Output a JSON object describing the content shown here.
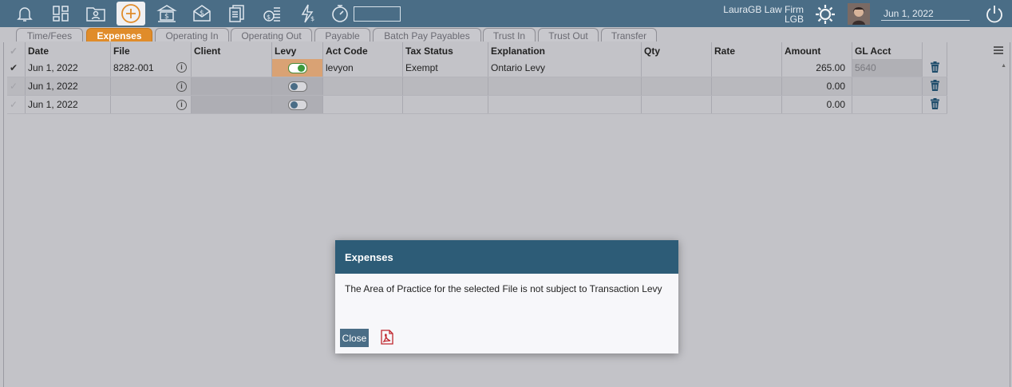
{
  "header": {
    "firm_name": "LauraGB Law Firm",
    "firm_code": "LGB",
    "date": "Jun 1, 2022",
    "search_value": ""
  },
  "tabs": [
    {
      "label": "Time/Fees"
    },
    {
      "label": "Expenses"
    },
    {
      "label": "Operating In"
    },
    {
      "label": "Operating Out"
    },
    {
      "label": "Payable"
    },
    {
      "label": "Batch Pay Payables"
    },
    {
      "label": "Trust In"
    },
    {
      "label": "Trust Out"
    },
    {
      "label": "Transfer"
    }
  ],
  "columns": [
    "Date",
    "File",
    "Client",
    "Levy",
    "Act Code",
    "Tax Status",
    "Explanation",
    "Qty",
    "Rate",
    "Amount",
    "GL Acct"
  ],
  "rows": [
    {
      "date": "Jun 1, 2022",
      "file": "8282-001",
      "client": "",
      "act_code": "levyon",
      "tax_status": "Exempt",
      "explanation": "Ontario Levy",
      "qty": "",
      "rate": "",
      "amount": "265.00",
      "gl_acct": "5640"
    },
    {
      "date": "Jun 1, 2022",
      "file": "",
      "client": "",
      "act_code": "",
      "tax_status": "",
      "explanation": "",
      "qty": "",
      "rate": "",
      "amount": "0.00",
      "gl_acct": ""
    },
    {
      "date": "Jun 1, 2022",
      "file": "",
      "client": "",
      "act_code": "",
      "tax_status": "",
      "explanation": "",
      "qty": "",
      "rate": "",
      "amount": "0.00",
      "gl_acct": ""
    }
  ],
  "modal": {
    "title": "Expenses",
    "message": "The Area of Practice for the selected File is not subject to Transaction Levy",
    "close_label": "Close"
  },
  "colors": {
    "topbar": "#4a6d86",
    "accent": "#e08c2a",
    "modal_header": "#2d5c77",
    "trash": "#1f4d6b",
    "pdf": "#c0262d"
  }
}
